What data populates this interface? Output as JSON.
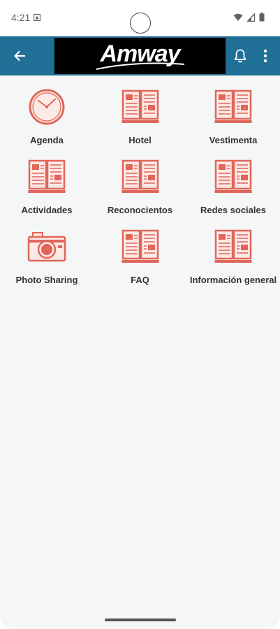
{
  "status_bar": {
    "time": "4:21"
  },
  "header": {
    "logo_text": "Amway",
    "colors": {
      "app_bar": "#1f6f96",
      "logo_bg": "#000000",
      "icon_accent": "#e0665a"
    }
  },
  "icons": {
    "back": "arrow-left-icon",
    "bell": "bell-icon",
    "menu": "more-vert-icon"
  },
  "tiles": [
    {
      "label": "Agenda",
      "icon": "clock-icon"
    },
    {
      "label": "Hotel",
      "icon": "book-icon"
    },
    {
      "label": "Vestimenta",
      "icon": "book-icon"
    },
    {
      "label": "Actividades",
      "icon": "book-icon"
    },
    {
      "label": "Reconocientos",
      "icon": "book-icon"
    },
    {
      "label": "Redes sociales",
      "icon": "book-icon"
    },
    {
      "label": "Photo Sharing",
      "icon": "camera-icon"
    },
    {
      "label": "FAQ",
      "icon": "book-icon"
    },
    {
      "label": "Información general",
      "icon": "book-icon"
    }
  ]
}
